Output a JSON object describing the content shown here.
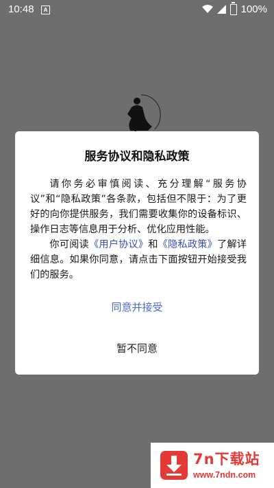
{
  "status_bar": {
    "time": "10:48",
    "notification_glyph": "A",
    "battery_level": "100%",
    "icons": [
      "a-notification-icon",
      "wifi-icon",
      "signal-icon",
      "battery-icon"
    ]
  },
  "dialog": {
    "title": "服务协议和隐私政策",
    "paragraph1": "请你务必审慎阅读、充分理解“服务协议”和“隐私政策”各条款，包括但不限于：为了更好的向你提供服务，我们需要收集你的设备标识、操作日志等信息用于分析、优化应用性能。",
    "paragraph2_prefix": "你可阅读",
    "user_agreement_link": "《用户协议》",
    "paragraph2_and": "和",
    "privacy_policy_link": "《隐私政策》",
    "paragraph2_suffix": "了解详细信息。如果你同意，请点击下面按钮开始接受我们的服务。",
    "accept_label": "同意并接受",
    "decline_label": "暂不同意"
  },
  "watermark": {
    "title": "7n下载站",
    "url": "www.7ndn.com"
  },
  "colors": {
    "overlay_background": "#6e6e6e",
    "dialog_background": "#ffffff",
    "link": "#3a4fb0",
    "accept_button": "#4b6ecb",
    "watermark_red": "#e53935"
  }
}
